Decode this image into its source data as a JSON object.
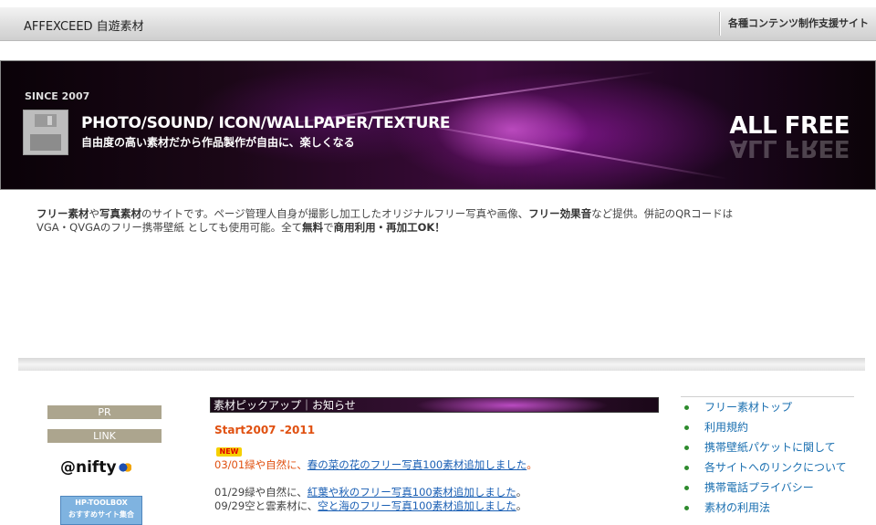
{
  "header": {
    "site_title": "AFFEXCEED  自遊素材",
    "tagline": "各種コンテンツ制作支援サイト"
  },
  "banner": {
    "since": "SINCE 2007",
    "title": "PHOTO/SOUND/ ICON/WALLPAPER/TEXTURE",
    "subtitle": "自由度の高い素材だから作品製作が自由に、楽しくなる",
    "all_free": "ALL FREE",
    "icon": "floppy-disk-icon"
  },
  "intro": {
    "p1": "フリー素材",
    "p2": "や",
    "p3": "写真素材",
    "p4": "のサイトです。ページ管理人自身が撮影し加工したオリジナルフリー写真や画像、",
    "p5": "フリー効果音",
    "p6": "など提供。併記のQRコードは",
    "p7": "VGA・QVGAのフリー携帯壁紙 としても使用可能。全て",
    "p8": "無料",
    "p9": "で",
    "p10": "商用利用",
    "p11": "・",
    "p12": "再加工OK！"
  },
  "left": {
    "pr": "PR",
    "link": "LINK",
    "nifty": "@nifty",
    "toolbox_line1": "HP-TOOLBOX",
    "toolbox_line2": "おすすめサイト集合"
  },
  "pickup": {
    "header": "素材ピックアップ｜お知らせ",
    "start": "Start2007 -2011",
    "new_badge": "NEW",
    "news": [
      {
        "date_text": "03/01緑や自然に、",
        "link": "春の菜の花のフリー写真100素材追加しました",
        "tail": "。"
      },
      {
        "date_text": "01/29緑や自然に、",
        "link": "紅葉や秋のフリー写真100素材追加しました",
        "tail": "。"
      },
      {
        "date_text": "09/29空と雲素材に、",
        "link": "空と海のフリー写真100素材追加しました",
        "tail": "。"
      }
    ]
  },
  "nav": {
    "items": [
      {
        "label": "フリー素材トップ"
      },
      {
        "label": "利用規約"
      },
      {
        "label": "携帯壁紙パケットに関して"
      },
      {
        "label": "各サイトへのリンクについて"
      },
      {
        "label": "携帯電話プライバシー"
      },
      {
        "label": "素材の利用法"
      }
    ]
  },
  "colors": {
    "accent_orange": "#e05010",
    "link_blue": "#1a5fb4",
    "nav_blue": "#1a6fb0",
    "bullet_green": "#2e8b2e",
    "side_tag": "#aca58e"
  }
}
